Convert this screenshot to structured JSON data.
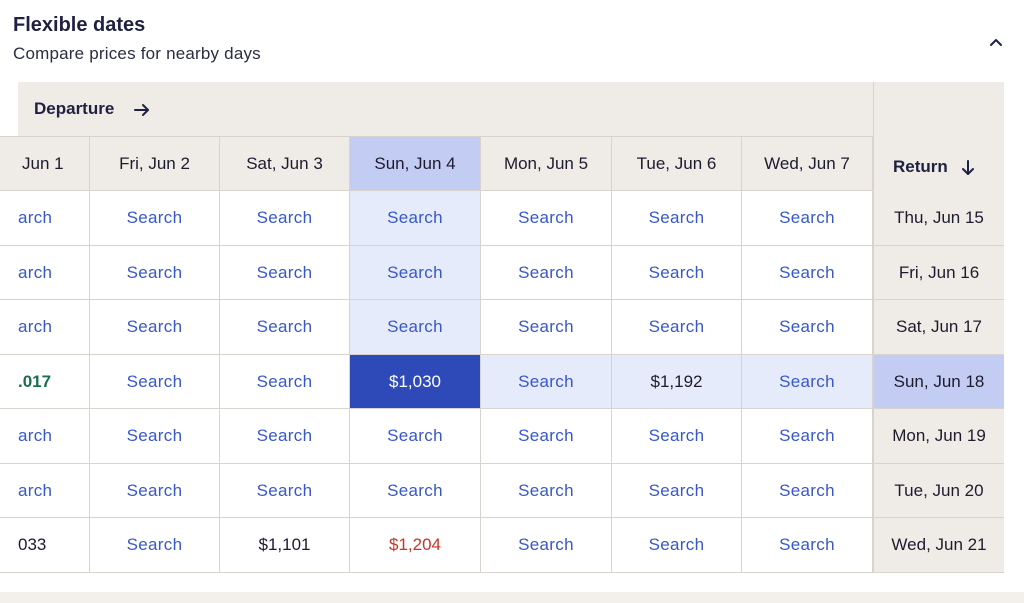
{
  "header": {
    "title": "Flexible dates",
    "subtitle": "Compare prices for nearby days",
    "collapse_icon": "chevron-up-icon"
  },
  "table": {
    "departure_label": "Departure",
    "return_label": "Return",
    "departure_columns": [
      {
        "label": "Jun 1"
      },
      {
        "label": "Fri, Jun 2"
      },
      {
        "label": "Sat, Jun 3"
      },
      {
        "label": "Sun, Jun 4",
        "selected": true
      },
      {
        "label": "Mon, Jun 5"
      },
      {
        "label": "Tue, Jun 6"
      },
      {
        "label": "Wed, Jun 7"
      }
    ],
    "rows": [
      {
        "return": "Thu, Jun 15",
        "cells": [
          "arch",
          "Search",
          "Search",
          "Search",
          "Search",
          "Search",
          "Search"
        ]
      },
      {
        "return": "Fri, Jun 16",
        "cells": [
          "arch",
          "Search",
          "Search",
          "Search",
          "Search",
          "Search",
          "Search"
        ]
      },
      {
        "return": "Sat, Jun 17",
        "cells": [
          "arch",
          "Search",
          "Search",
          "Search",
          "Search",
          "Search",
          "Search"
        ]
      },
      {
        "return": "Sun, Jun 18",
        "selected": true,
        "cells": [
          ".017",
          "Search",
          "Search",
          "$1,030",
          "Search",
          "$1,192",
          "Search"
        ]
      },
      {
        "return": "Mon, Jun 19",
        "cells": [
          "arch",
          "Search",
          "Search",
          "Search",
          "Search",
          "Search",
          "Search"
        ]
      },
      {
        "return": "Tue, Jun 20",
        "cells": [
          "arch",
          "Search",
          "Search",
          "Search",
          "Search",
          "Search",
          "Search"
        ]
      },
      {
        "return": "Wed, Jun 21",
        "cells": [
          "033",
          "Search",
          "$1,101",
          "$1,204",
          "Search",
          "Search",
          "Search"
        ]
      }
    ],
    "price_colors": {
      "cheapest": "#1b6e54",
      "expensive": "#c2362c",
      "selected_bg": "#2e4ab8",
      "highlight_bg": "#e6ebfb",
      "selected_header_bg": "#c3cdf4",
      "search_link": "#3858c9"
    },
    "cell_tones": {
      "0,3": "green",
      "6,3": "red"
    }
  }
}
